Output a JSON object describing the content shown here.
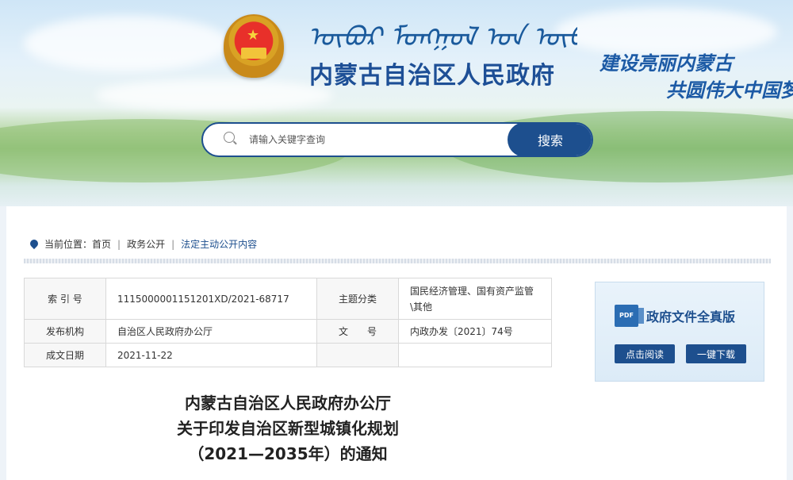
{
  "header": {
    "mongolian_title": "ᠦᠪᠦᠷ ᠮᠣᠩᠭᠣᠯ ᠤᠨ ᠥᠪᠡᠷᠲᠡᠭᠡᠨ ᠵᠠᠰᠠᠬᠤ",
    "site_title": "内蒙古自治区人民政府",
    "slogan_line1": "建设亮丽内蒙古",
    "slogan_line2": "共圆伟大中国梦"
  },
  "search": {
    "placeholder": "请输入关键字查询",
    "button_label": "搜索"
  },
  "breadcrumb": {
    "prefix": "当前位置：",
    "items": [
      "首页",
      "政务公开",
      "法定主动公开内容"
    ]
  },
  "meta": {
    "index_label": "索 引 号",
    "index_value": "1115000001151201XD/2021-68717",
    "topic_label": "主题分类",
    "topic_value": "国民经济管理、国有资产监管\\其他",
    "publisher_label": "发布机构",
    "publisher_value": "自治区人民政府办公厅",
    "docno_label": "文　　号",
    "docno_value": "内政办发〔2021〕74号",
    "date_label": "成文日期",
    "date_value": "2021-11-22"
  },
  "document": {
    "title_line1": "内蒙古自治区人民政府办公厅",
    "title_line2": "关于印发自治区新型城镇化规划",
    "title_line3": "（2021—2035年）的通知"
  },
  "sidebox": {
    "pdf_icon_text": "PDF",
    "title": "政府文件全真版",
    "read_label": "点击阅读",
    "download_label": "一键下载"
  }
}
